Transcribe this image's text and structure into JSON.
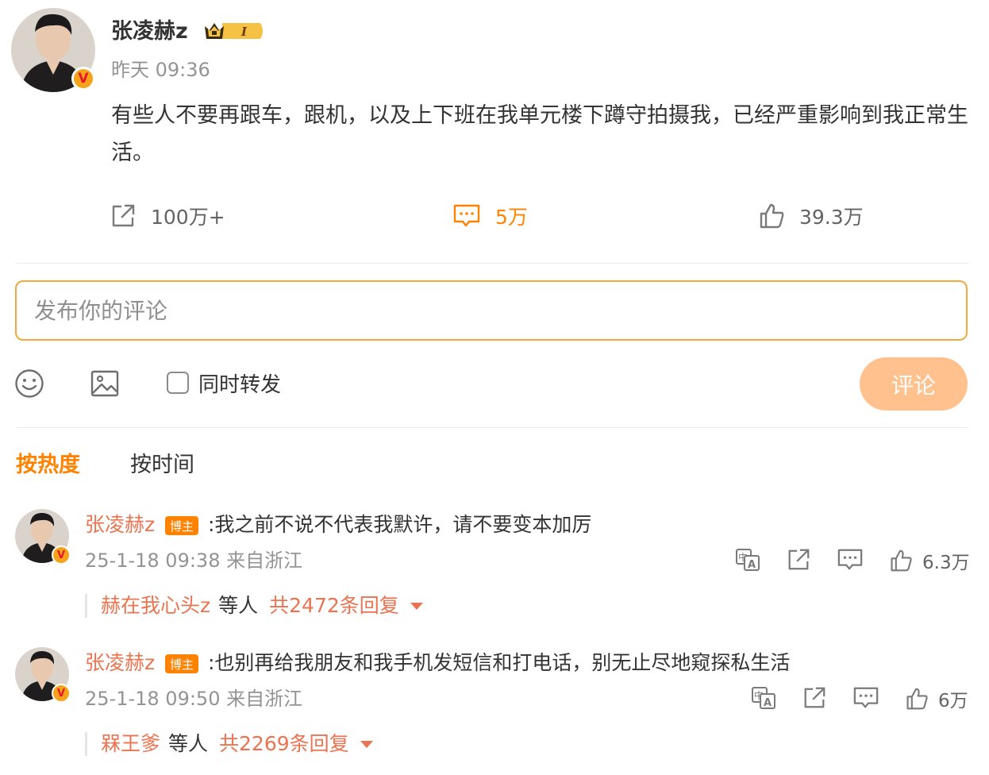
{
  "post": {
    "author": "张凌赫z",
    "rank_level": "I",
    "time": "昨天 09:36",
    "text": "有些人不要再跟车，跟机，以及上下班在我单元楼下蹲守拍摄我，已经严重影响到我正常生活。",
    "verify_mark": "V",
    "actions": {
      "repost_count": "100万+",
      "comment_count": "5万",
      "like_count": "39.3万"
    }
  },
  "composer": {
    "placeholder": "发布你的评论",
    "also_repost_label": "同时转发",
    "submit_label": "评论"
  },
  "sort_tabs": {
    "hot": "按热度",
    "time": "按时间"
  },
  "comments": [
    {
      "author": "张凌赫z",
      "host_tag": "博主",
      "text": ":我之前不说不代表我默许，请不要变本加厉",
      "meta": "25-1-18 09:38 来自浙江",
      "likes": "6.3万",
      "verify_mark": "V",
      "reply_names": "赫在我心头z",
      "reply_etc": "等人",
      "reply_total": "共2472条回复"
    },
    {
      "author": "张凌赫z",
      "host_tag": "博主",
      "text": ":也别再给我朋友和我手机发短信和打电话，别无止尽地窥探私生活",
      "meta": "25-1-18 09:50 来自浙江",
      "likes": "6万",
      "verify_mark": "V",
      "reply_names": "槑王爹",
      "reply_etc": "等人",
      "reply_total": "共2269条回复"
    }
  ],
  "colors": {
    "accent": "#ff8200",
    "author_link": "#eb7350",
    "submit_disabled": "#ffc28f",
    "input_border": "#f0a93f",
    "meta_gray": "#939393"
  },
  "icons": [
    "repost-icon",
    "comment-icon",
    "like-icon",
    "emoji-icon",
    "image-icon",
    "translate-icon",
    "share-icon",
    "reply-icon",
    "chevron-down-icon",
    "verified-badge-icon"
  ]
}
